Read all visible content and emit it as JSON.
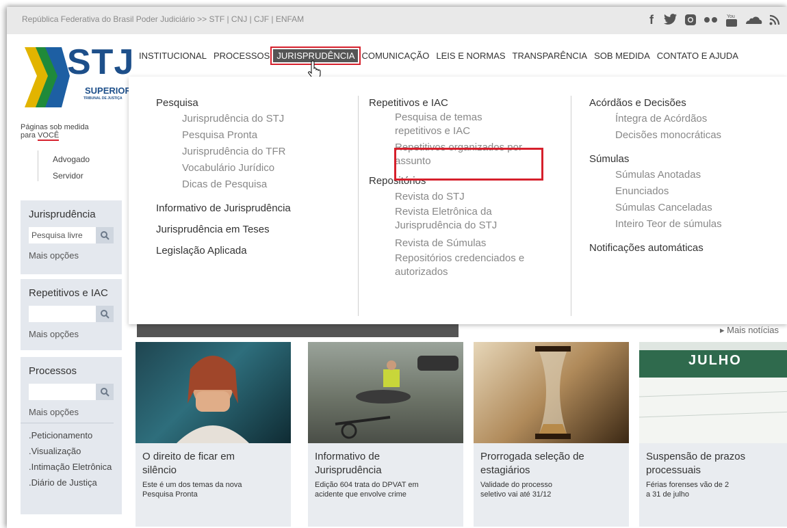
{
  "top_bar": {
    "gov_text": "República Federativa do Brasil Poder Judiciário >> STF | CNJ | CJF | ENFAM",
    "social": [
      "f",
      "twitter-icon",
      "instagram-icon",
      "flickr-icon",
      "youtube-icon",
      "soundcloud-icon",
      "rss-icon"
    ]
  },
  "logo": {
    "name": "STJ",
    "subtitle": "SUPERIOR",
    "sub2": "TRIBUNAL DE JUSTIÇA"
  },
  "nav": {
    "items": [
      "INSTITUCIONAL",
      "PROCESSOS",
      "JURISPRUDÊNCIA",
      "COMUNICAÇÃO",
      "LEIS E NORMAS",
      "TRANSPARÊNCIA",
      "SOB MEDIDA",
      "CONTATO E AJUDA"
    ],
    "active": "JURISPRUDÊNCIA"
  },
  "mega": {
    "col1": {
      "h1": "Pesquisa",
      "subs": [
        "Jurisprudência do STJ",
        "Pesquisa Pronta",
        "Jurisprudência do TFR",
        "Vocabulário Jurídico",
        "Dicas de Pesquisa"
      ],
      "h2": "Informativo de Jurisprudência",
      "h3": "Jurisprudência em Teses",
      "h4": "Legislação Aplicada"
    },
    "col2": {
      "h1": "Repetitivos e IAC",
      "subs": [
        "Pesquisa de temas repetitivos e IAC",
        "Repetitivos organizados por assunto"
      ],
      "h2": "Repositórios",
      "subs2": [
        "Revista do STJ",
        "Revista Eletrônica da Jurisprudência do STJ",
        "Revista de Súmulas",
        "Repositórios credenciados e autorizados"
      ]
    },
    "col3": {
      "h1": "Acórdãos e Decisões",
      "subs": [
        "Íntegra de Acórdãos",
        "Decisões monocráticas"
      ],
      "h2": "Súmulas",
      "subs2": [
        "Súmulas Anotadas",
        "Enunciados",
        "Súmulas Canceladas",
        "Inteiro Teor de súmulas"
      ],
      "h3": "Notificações automáticas"
    }
  },
  "sidebar": {
    "paginas": "Páginas sob medida",
    "para": "para",
    "voce": "VOCÊ",
    "advogado": "Advogado",
    "servidor": "Servidor",
    "juris": {
      "title": "Jurisprudência",
      "placeholder": "Pesquisa livre",
      "more": "Mais opções"
    },
    "repet": {
      "title": "Repetitivos e IAC",
      "more": "Mais opções"
    },
    "proc": {
      "title": "Processos",
      "more": "Mais opções",
      "links": [
        ".Peticionamento",
        ".Visualização",
        ".Intimação Eletrônica",
        ".Diário de Justiça"
      ]
    }
  },
  "mais_noticias": "▸ Mais notícias",
  "cards": [
    {
      "title": "O direito de ficar em silêncio",
      "desc": "Este é um dos temas da nova Pesquisa Pronta"
    },
    {
      "title": "Informativo de Jurisprudência",
      "desc": "Edição 604 trata do DPVAT em acidente que envolve crime"
    },
    {
      "title": "Prorrogada seleção de estagiários",
      "desc": "Validade do processo seletivo vai até 31/12"
    },
    {
      "title": "Suspensão de prazos processuais",
      "desc": "Férias forenses vão de 2 a 31 de julho"
    }
  ],
  "calendar_month": "JULHO",
  "colors": {
    "accent_red": "#d6202c",
    "nav_active_bg": "#555555",
    "sidebar_box": "#e4e8ee"
  }
}
